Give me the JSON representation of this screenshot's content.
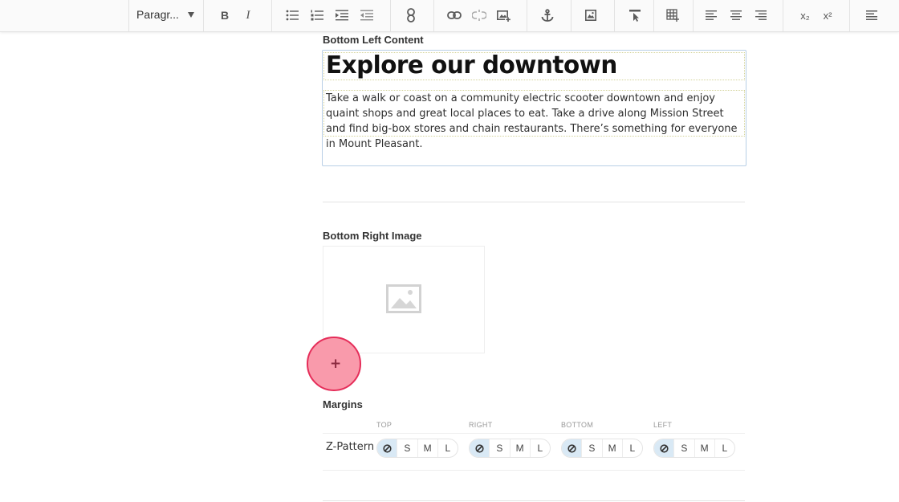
{
  "toolbar": {
    "format_select": "Paragr...",
    "bold": "B",
    "italic": "I",
    "subscript": "x₂",
    "superscript": "x²"
  },
  "fields": {
    "bottom_left_content": {
      "label": "Bottom Left Content",
      "heading": "Explore our downtown",
      "paragraph": "Take a walk or coast on a community electric scooter downtown and enjoy quaint shops and great local places to eat. Take a drive along Mission Street and find big-box stores and chain restaurants. There’s something for everyone in Mount Pleasant."
    },
    "bottom_right_image": {
      "label": "Bottom Right Image",
      "add_symbol": "+"
    },
    "margins": {
      "label": "Margins",
      "columns": [
        "TOP",
        "RIGHT",
        "BOTTOM",
        "LEFT"
      ],
      "row_label": "Z-Pattern",
      "options": [
        "S",
        "M",
        "L"
      ]
    }
  },
  "colors": {
    "accent_pink": "#f99aab",
    "accent_pink_border": "#e52d59",
    "selected_segment": "#d9e9f5"
  }
}
